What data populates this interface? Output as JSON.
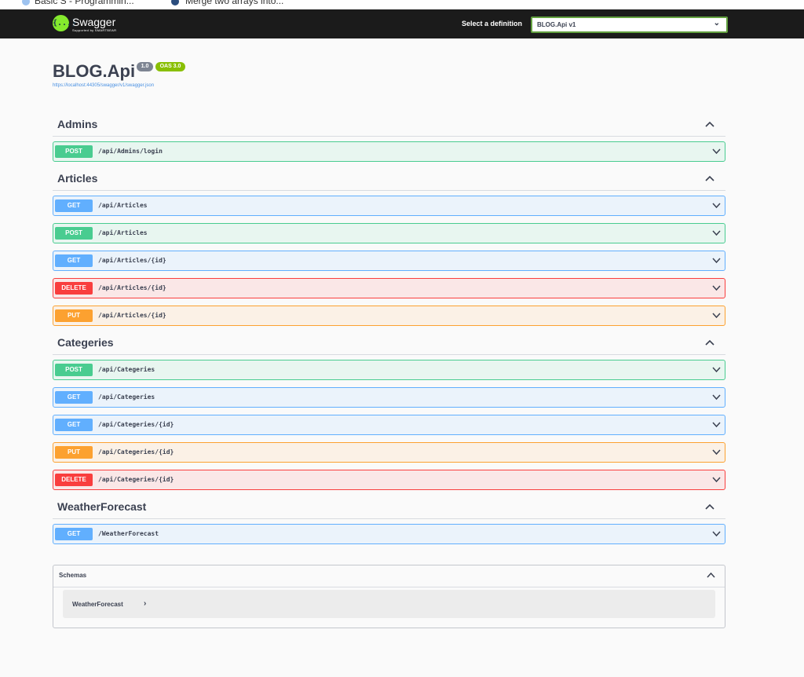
{
  "browser": {
    "bookmarks": [
      "Basic S - Programmin...",
      "Merge two arrays into..."
    ]
  },
  "topbar": {
    "logo_icon": "{...}",
    "logo_text": "Swagger",
    "logo_sub": "Supported by SMARTBEAR",
    "select_label": "Select a definition",
    "select_value": "BLOG.Api v1",
    "accent": "#85ea2d"
  },
  "info": {
    "title": "BLOG.Api",
    "version": "1.0",
    "oas": "OAS 3.0",
    "url": "https://localhost:44305/swagger/v1/swagger.json"
  },
  "tags": [
    {
      "name": "Admins",
      "operations": [
        {
          "method": "POST",
          "path": "/api/Admins/login"
        }
      ]
    },
    {
      "name": "Articles",
      "operations": [
        {
          "method": "GET",
          "path": "/api/Articles"
        },
        {
          "method": "POST",
          "path": "/api/Articles"
        },
        {
          "method": "GET",
          "path": "/api/Articles/{id}"
        },
        {
          "method": "DELETE",
          "path": "/api/Articles/{id}"
        },
        {
          "method": "PUT",
          "path": "/api/Articles/{id}"
        }
      ]
    },
    {
      "name": "Categeries",
      "operations": [
        {
          "method": "POST",
          "path": "/api/Categeries"
        },
        {
          "method": "GET",
          "path": "/api/Categeries"
        },
        {
          "method": "GET",
          "path": "/api/Categeries/{id}"
        },
        {
          "method": "PUT",
          "path": "/api/Categeries/{id}"
        },
        {
          "method": "DELETE",
          "path": "/api/Categeries/{id}"
        }
      ]
    },
    {
      "name": "WeatherForecast",
      "operations": [
        {
          "method": "GET",
          "path": "/WeatherForecast"
        }
      ]
    }
  ],
  "schemas": {
    "title": "Schemas",
    "models": [
      "WeatherForecast"
    ]
  },
  "colors": {
    "post": "#49cc90",
    "get": "#61affe",
    "delete": "#f93e3e",
    "put": "#fca130"
  }
}
